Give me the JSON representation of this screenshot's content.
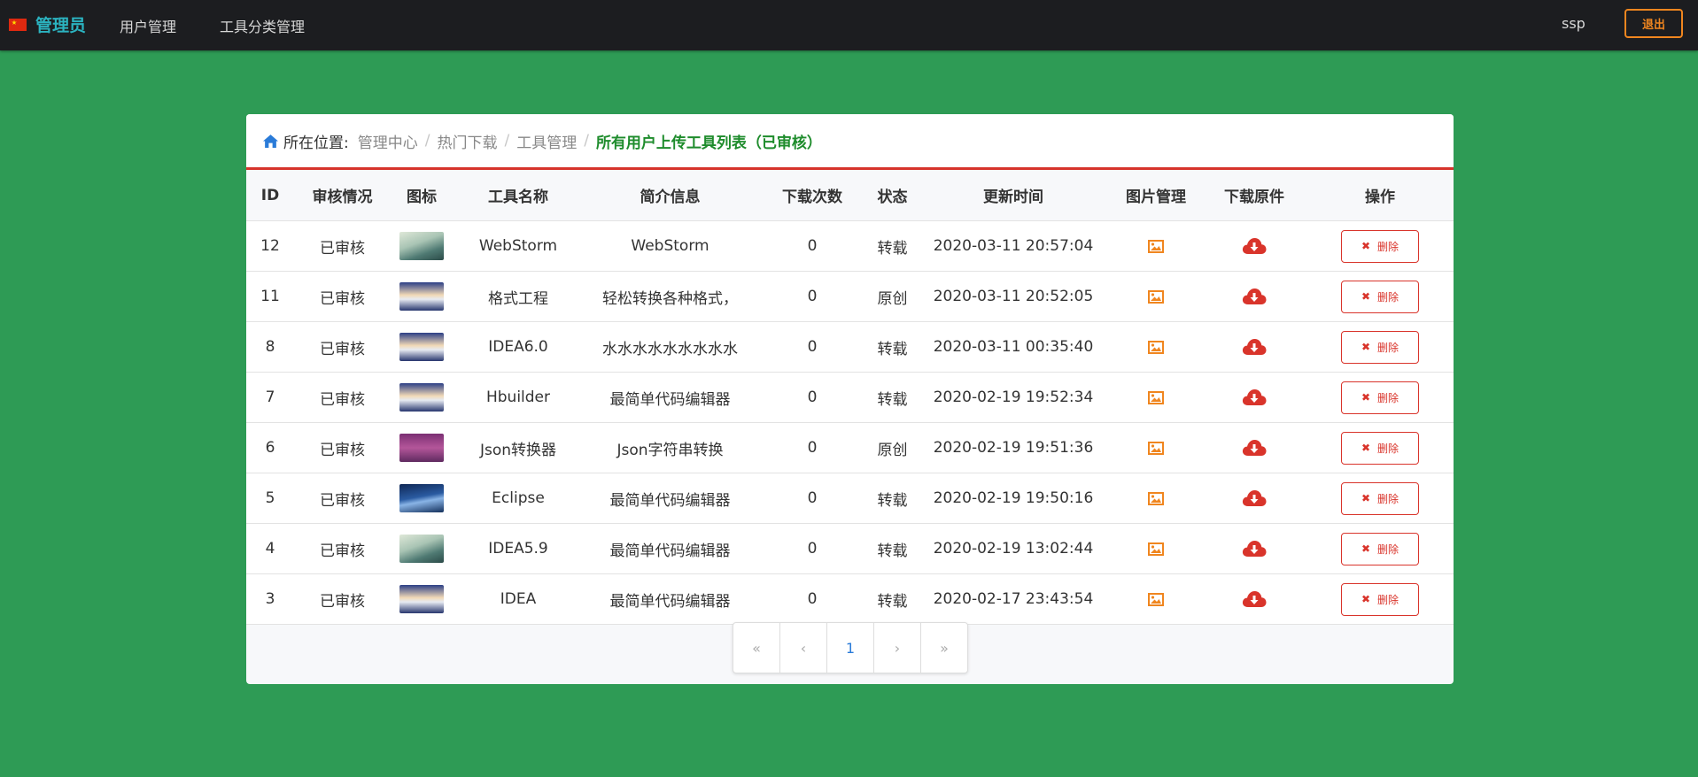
{
  "nav": {
    "brand": "管理员",
    "links": [
      "用户管理",
      "工具分类管理"
    ],
    "username": "ssp",
    "logout_label": "退出"
  },
  "breadcrumb": {
    "label": "所在位置:",
    "items": [
      "管理中心",
      "热门下载",
      "工具管理"
    ],
    "active": "所有用户上传工具列表（已审核）"
  },
  "table": {
    "headers": [
      "ID",
      "审核情况",
      "图标",
      "工具名称",
      "简介信息",
      "下载次数",
      "状态",
      "更新时间",
      "图片管理",
      "下载原件",
      "操作"
    ],
    "delete_label": "删除",
    "rows": [
      {
        "id": "12",
        "audit": "已审核",
        "thumb": "mountain-figure",
        "name": "WebStorm",
        "desc": "WebStorm",
        "downloads": "0",
        "status": "转载",
        "updated": "2020-03-11 20:57:04"
      },
      {
        "id": "11",
        "audit": "已审核",
        "thumb": "bridge-blue",
        "name": "格式工程",
        "desc": "轻松转换各种格式，",
        "downloads": "0",
        "status": "原创",
        "updated": "2020-03-11 20:52:05"
      },
      {
        "id": "8",
        "audit": "已审核",
        "thumb": "bridge-blue",
        "name": "IDEA6.0",
        "desc": "水水水水水水水水水",
        "downloads": "0",
        "status": "转载",
        "updated": "2020-03-11 00:35:40"
      },
      {
        "id": "7",
        "audit": "已审核",
        "thumb": "bridge-blue",
        "name": "Hbuilder",
        "desc": "最简单代码编辑器",
        "downloads": "0",
        "status": "转载",
        "updated": "2020-02-19 19:52:34"
      },
      {
        "id": "6",
        "audit": "已审核",
        "thumb": "purple-castle",
        "name": "Json转换器",
        "desc": "Json字符串转换",
        "downloads": "0",
        "status": "原创",
        "updated": "2020-02-19 19:51:36"
      },
      {
        "id": "5",
        "audit": "已审核",
        "thumb": "dark-blue-landscape",
        "name": "Eclipse",
        "desc": "最简单代码编辑器",
        "downloads": "0",
        "status": "转载",
        "updated": "2020-02-19 19:50:16"
      },
      {
        "id": "4",
        "audit": "已审核",
        "thumb": "mountain-figure",
        "name": "IDEA5.9",
        "desc": "最简单代码编辑器",
        "downloads": "0",
        "status": "转载",
        "updated": "2020-02-19 13:02:44"
      },
      {
        "id": "3",
        "audit": "已审核",
        "thumb": "bridge-blue",
        "name": "IDEA",
        "desc": "最简单代码编辑器",
        "downloads": "0",
        "status": "转载",
        "updated": "2020-02-17 23:43:54"
      }
    ]
  },
  "pagination": {
    "first": "«",
    "prev": "‹",
    "current": "1",
    "next": "›",
    "last": "»"
  },
  "colors": {
    "background": "#2e9b55",
    "navbar": "#1c1d20",
    "brand": "#2bb3c0",
    "accent_red": "#d9342b",
    "image_icon": "#f0861f",
    "breadcrumb_active": "#1e8c2c"
  }
}
